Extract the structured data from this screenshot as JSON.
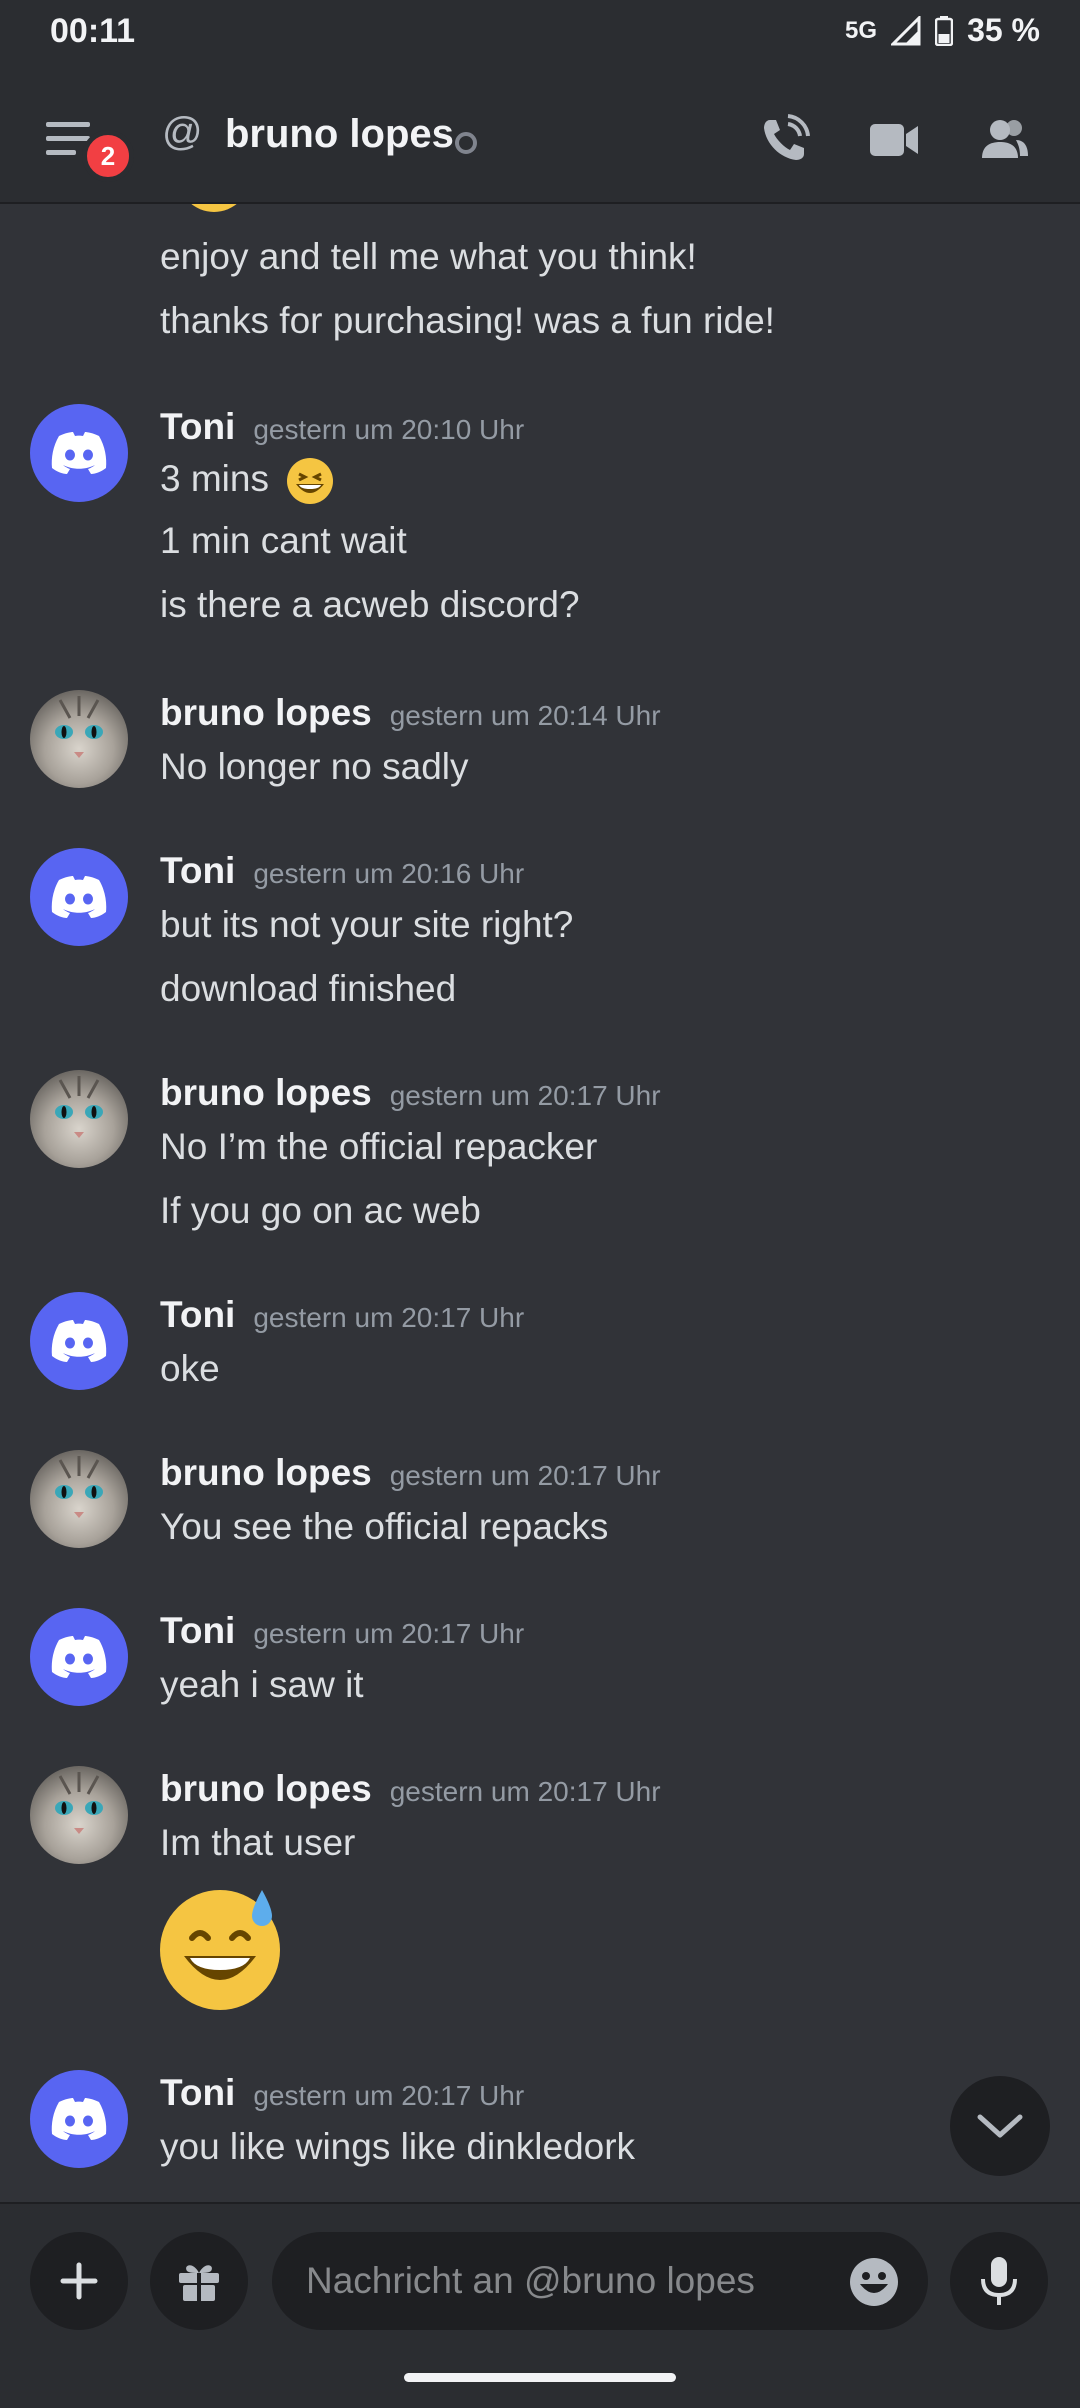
{
  "status_bar": {
    "time": "00:11",
    "network": "5G",
    "battery": "35 %"
  },
  "header": {
    "at_symbol": "@",
    "title": "bruno lopes",
    "unread_badge": "2"
  },
  "messages": [
    {
      "lines": [
        "enjoy and tell me what you think!",
        "thanks for purchasing! was a fun ride!"
      ]
    },
    {
      "author": "Toni",
      "timestamp": "gestern um 20:10 Uhr",
      "lines": [
        "3 mins",
        "1 min cant wait",
        "is there a acweb discord?"
      ],
      "inline_emoji": "grinning-squinting"
    },
    {
      "author": "bruno lopes",
      "timestamp": "gestern um 20:14 Uhr",
      "lines": [
        "No longer no sadly"
      ]
    },
    {
      "author": "Toni",
      "timestamp": "gestern um 20:16 Uhr",
      "lines": [
        "but its not your site right?",
        "download finished"
      ]
    },
    {
      "author": "bruno lopes",
      "timestamp": "gestern um 20:17 Uhr",
      "lines": [
        "No I’m the official repacker",
        "If you go on ac web"
      ]
    },
    {
      "author": "Toni",
      "timestamp": "gestern um 20:17 Uhr",
      "lines": [
        "oke"
      ]
    },
    {
      "author": "bruno lopes",
      "timestamp": "gestern um 20:17 Uhr",
      "lines": [
        "You see the official repacks"
      ]
    },
    {
      "author": "Toni",
      "timestamp": "gestern um 20:17 Uhr",
      "lines": [
        "yeah i saw it"
      ]
    },
    {
      "author": "bruno lopes",
      "timestamp": "gestern um 20:17 Uhr",
      "lines": [
        "Im that user"
      ],
      "big_emoji": "grinning-sweat"
    },
    {
      "author": "Toni",
      "timestamp": "gestern um 20:17 Uhr",
      "lines": [
        "you like wings like dinkledork"
      ]
    }
  ],
  "composer": {
    "placeholder": "Nachricht an @bruno lopes"
  },
  "colors": {
    "background": "#313338",
    "header": "#2b2d31",
    "blurple": "#5865f2",
    "badge": "#f23f43"
  },
  "icons": [
    "menu-icon",
    "at-icon",
    "phone-call-icon",
    "video-call-icon",
    "members-icon",
    "plus-icon",
    "gift-icon",
    "emoji-icon",
    "microphone-icon",
    "chevron-down-icon"
  ]
}
